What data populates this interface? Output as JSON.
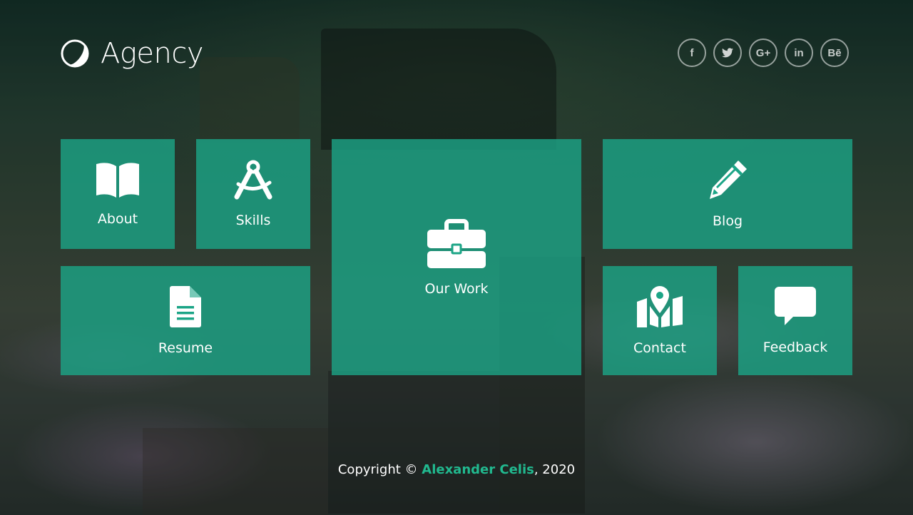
{
  "brand": {
    "name": "Agency",
    "icon": "half-moon-logo-icon"
  },
  "social": [
    {
      "name": "facebook-icon",
      "glyph": "f"
    },
    {
      "name": "twitter-icon",
      "glyph": "t"
    },
    {
      "name": "google-plus-icon",
      "glyph": "G+"
    },
    {
      "name": "linkedin-icon",
      "glyph": "in"
    },
    {
      "name": "behance-icon",
      "glyph": "Bē"
    }
  ],
  "tiles": {
    "about": {
      "label": "About",
      "icon": "book-open-icon"
    },
    "skills": {
      "label": "Skills",
      "icon": "drafting-compass-icon"
    },
    "resume": {
      "label": "Resume",
      "icon": "file-text-icon"
    },
    "work": {
      "label": "Our Work",
      "icon": "briefcase-icon"
    },
    "blog": {
      "label": "Blog",
      "icon": "pencil-icon"
    },
    "contact": {
      "label": "Contact",
      "icon": "map-marker-icon"
    },
    "feedback": {
      "label": "Feedback",
      "icon": "comment-icon"
    }
  },
  "footer": {
    "prefix": "Copyright © ",
    "author": "Alexander Celis",
    "suffix": ", 2020"
  },
  "colors": {
    "tile": "#1ca587",
    "accent": "#21b98f",
    "text": "#ffffff"
  }
}
